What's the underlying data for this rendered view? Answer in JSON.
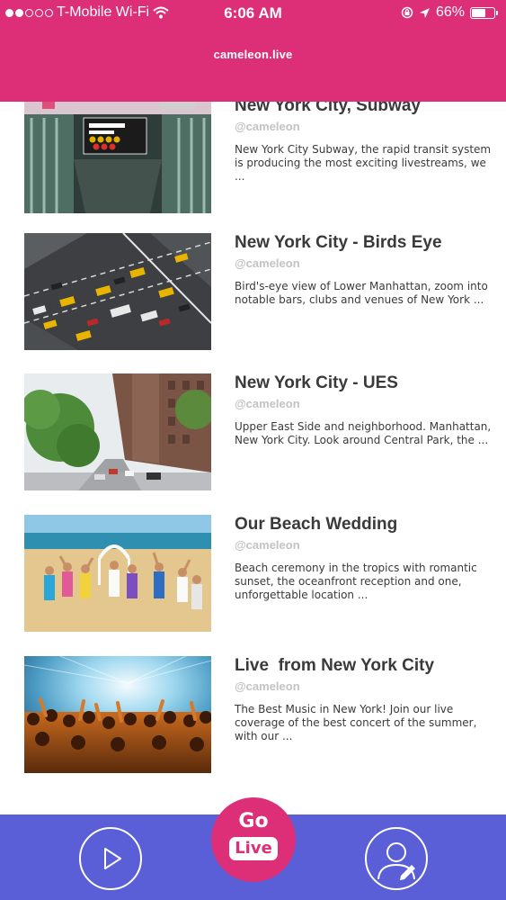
{
  "status_bar": {
    "carrier": "T-Mobile Wi-Fi",
    "time": "6:06 AM",
    "battery_label": "66%",
    "battery_level": 0.66,
    "signal_bars_filled": 2,
    "signal_bars_total": 5
  },
  "header": {
    "title": "cameleon.live"
  },
  "feed": {
    "items": [
      {
        "title": "New York City, Subway",
        "handle": "@cameleon",
        "description": "New York City Subway, the rapid transit system is producing the most exciting livestreams, we ...",
        "thumbnail": "subway-station-entrance-image"
      },
      {
        "title": "New York City - Birds Eye",
        "handle": "@cameleon",
        "description": "Bird's-eye view of Lower Manhattan, zoom into notable bars, clubs and venues of New York ...",
        "thumbnail": "aerial-traffic-image"
      },
      {
        "title": "New York City - UES",
        "handle": "@cameleon",
        "description": "Upper East Side and neighborhood. Manhattan, New York City. Look around Central Park, the ...",
        "thumbnail": "street-avenue-image"
      },
      {
        "title": "Our Beach Wedding",
        "handle": "@cameleon",
        "description": "Beach ceremony in the tropics with romantic sunset, the oceanfront reception and one, unforgettable location ...",
        "thumbnail": "beach-wedding-image"
      },
      {
        "title": "Live  from New York City",
        "handle": "@cameleon",
        "description": "The Best Music in New York! Join our live coverage of the best concert of the summer, with our ...",
        "thumbnail": "concert-crowd-image"
      }
    ]
  },
  "bottom_bar": {
    "go_text": "Go",
    "live_text": "Live",
    "icons": [
      "play-icon",
      "profile-icon"
    ]
  },
  "colors": {
    "header": "#dc2f78",
    "bottom_bar": "#5b5fd7",
    "title_text": "#3a3a3a",
    "handle_text": "#c3c3c3"
  }
}
